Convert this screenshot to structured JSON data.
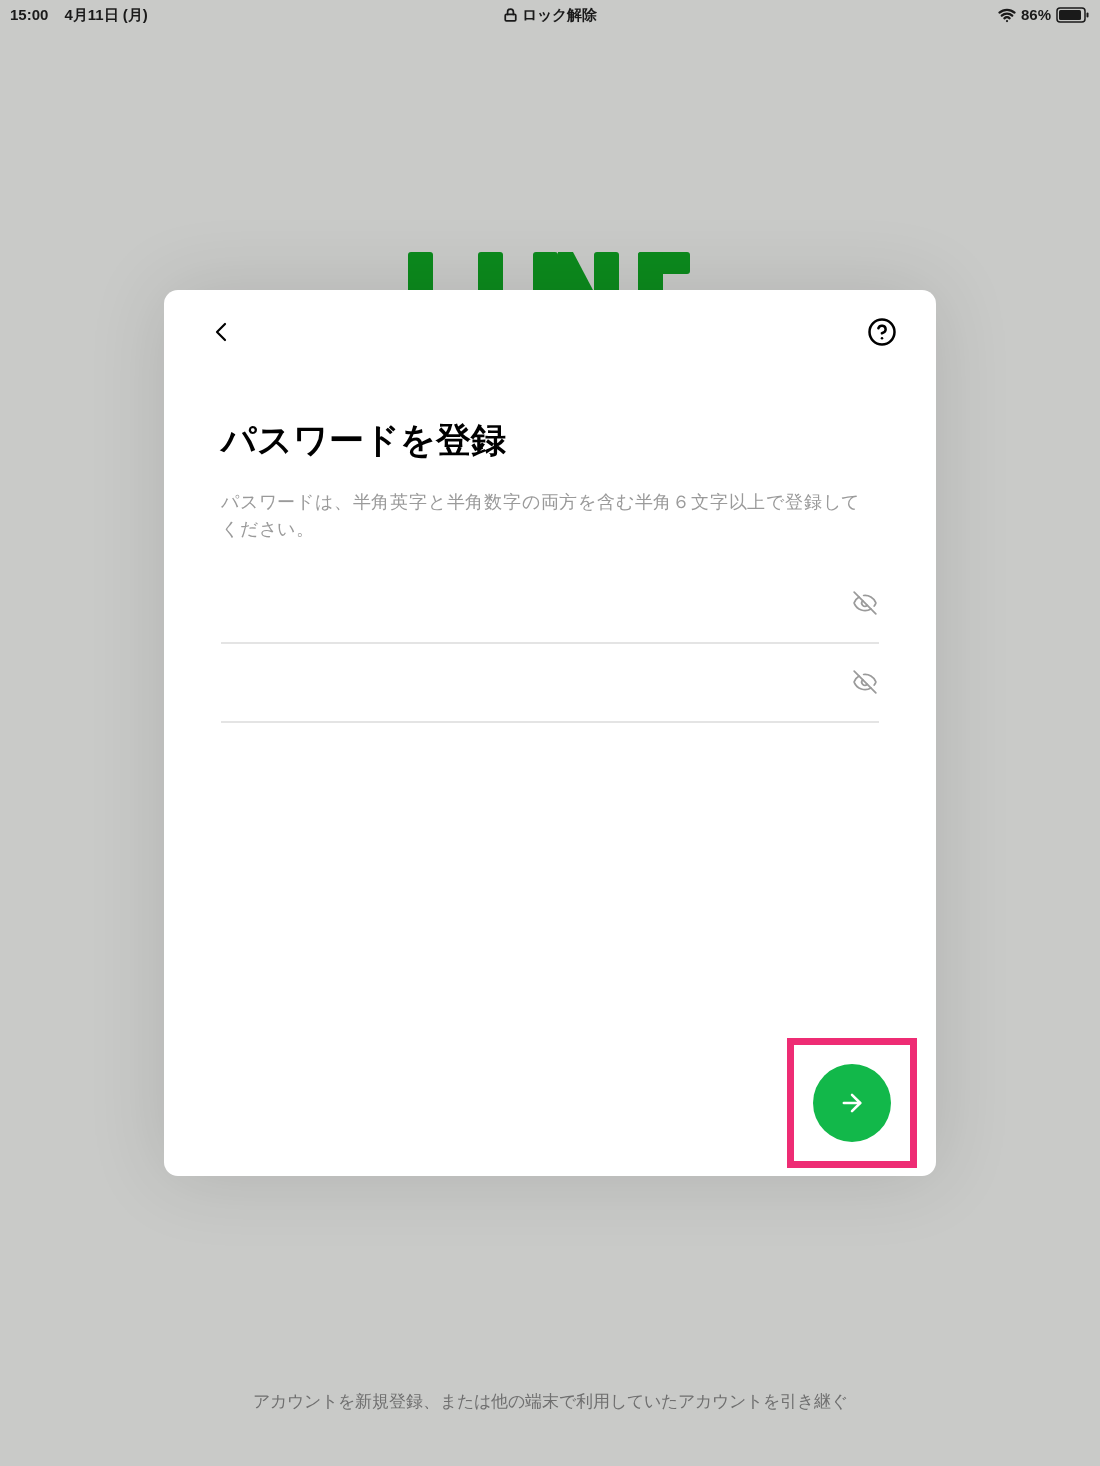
{
  "status_bar": {
    "time": "15:00",
    "date": "4月11日 (月)",
    "lock_label": "ロック解除",
    "battery": "86%"
  },
  "dialog": {
    "title": "パスワードを登録",
    "description": "パスワードは、半角英字と半角数字の両方を含む半角６文字以上で登録してください。",
    "fields": [
      {
        "masked": true
      },
      {
        "masked": true
      }
    ],
    "next_button": {
      "highlighted": true
    }
  },
  "footer": {
    "text": "アカウントを新規登録、または他の端末で利用していたアカウントを引き継ぐ"
  }
}
